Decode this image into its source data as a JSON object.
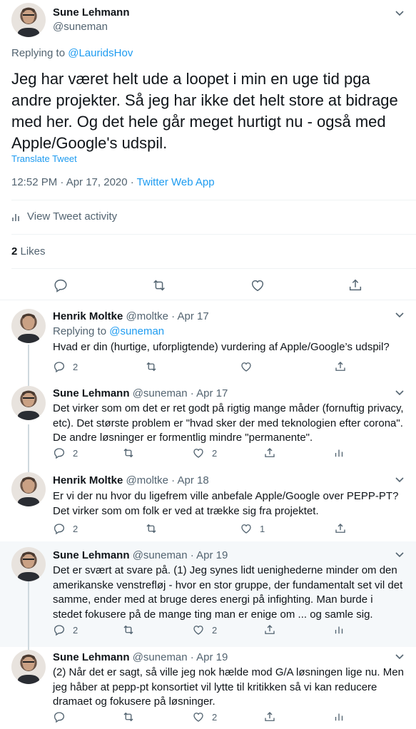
{
  "main": {
    "name": "Sune Lehmann",
    "handle": "@suneman",
    "replying_prefix": "Replying to ",
    "replying_to": "@LauridsHov",
    "text": "Jeg har været helt ude a loopet i min en uge tid pga andre projekter. Så jeg har ikke det helt store at bidrage med her. Og det hele går meget hurtigt nu - også med Apple/Google's udspil.",
    "translate": "Translate Tweet",
    "time": "12:52 PM · Apr 17, 2020 · ",
    "source": "Twitter Web App",
    "activity": "View Tweet activity",
    "likes_count": "2",
    "likes_label": " Likes"
  },
  "replies": [
    {
      "name": "Henrik Moltke",
      "handle": "@moltke",
      "sep": " · ",
      "date": "Apr 17",
      "replying_prefix": "Replying to ",
      "replying_to": "@suneman",
      "text": "Hvad er din (hurtige, uforpligtende) vurdering af Apple/Google’s udspil?",
      "reply_count": "2",
      "like_count": ""
    },
    {
      "name": "Sune Lehmann",
      "handle": "@suneman",
      "sep": " · ",
      "date": "Apr 17",
      "text": "Det virker som om det er ret godt på rigtig mange måder (fornuftig privacy, etc). Det største problem er \"hvad sker der med teknologien efter corona\". De andre løsninger er formentlig mindre \"permanente\".",
      "reply_count": "2",
      "like_count": "2"
    },
    {
      "name": "Henrik Moltke",
      "handle": "@moltke",
      "sep": " · ",
      "date": "Apr 18",
      "text": "Er vi der nu hvor du ligefrem ville anbefale Apple/Google over PEPP-PT? Det virker som om folk er ved at trække sig fra projektet.",
      "reply_count": "2",
      "like_count": "1"
    },
    {
      "name": "Sune Lehmann",
      "handle": "@suneman",
      "sep": " · ",
      "date": "Apr 19",
      "text": "Det er svært at svare på. (1) Jeg synes lidt uenighederne minder om den amerikanske venstrefløj - hvor en stor gruppe, der fundamentalt set vil det samme, ender med at bruge deres energi på infighting. Man burde i stedet fokusere på de mange ting man er enige om ... og samle sig.",
      "reply_count": "2",
      "like_count": "2"
    },
    {
      "name": "Sune Lehmann",
      "handle": "@suneman",
      "sep": " · ",
      "date": "Apr 19",
      "text": "(2) Når det er sagt, så ville jeg nok hælde mod G/A løsningen lige nu. Men jeg håber at pepp-pt konsortiet vil lytte til kritikken så vi kan reducere dramaet og fokusere på løsninger.",
      "reply_count": "",
      "like_count": "2"
    }
  ],
  "icons": [
    "chevron-down-icon",
    "reply-icon",
    "retweet-icon",
    "like-icon",
    "share-icon",
    "analytics-icon"
  ],
  "colors": {
    "link": "#1d9bf0",
    "muted": "#536471",
    "text": "#0f1419",
    "highlight_bg": "#f5f8fa"
  }
}
